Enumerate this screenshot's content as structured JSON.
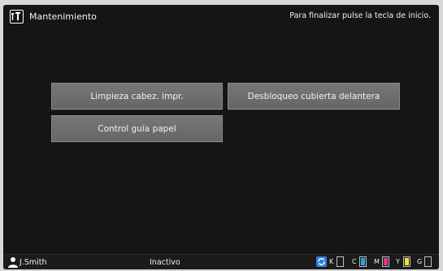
{
  "header": {
    "title": "Mantenimiento",
    "hint": "Para finalizar pulse la tecla de inicio."
  },
  "buttons": [
    {
      "label": "Limpieza cabez. impr."
    },
    {
      "label": "Desbloqueo cubierta delantera"
    },
    {
      "label": "Control guía papel"
    }
  ],
  "statusbar": {
    "user": "J.Smith",
    "status": "Inactivo",
    "inks": [
      {
        "letter": "K",
        "color": "#1b1b1b",
        "level": 0
      },
      {
        "letter": "C",
        "color": "#19a9df",
        "level": 1
      },
      {
        "letter": "M",
        "color": "#e5338d",
        "level": 1
      },
      {
        "letter": "Y",
        "color": "#f0e52a",
        "level": 1
      },
      {
        "letter": "G",
        "color": "#8f8f8f",
        "level": 0
      }
    ]
  },
  "colors": {
    "background": "#151515",
    "button": "#6e6e6e",
    "sync": "#2f7fd8"
  }
}
